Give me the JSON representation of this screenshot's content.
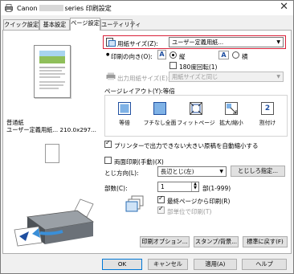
{
  "window": {
    "title_prefix": "Canon",
    "title_suffix": "series 印刷設定",
    "close_glyph": "✕"
  },
  "tabs": [
    {
      "label": "クイック設定"
    },
    {
      "label": "基本設定"
    },
    {
      "label": "ページ設定"
    },
    {
      "label": "ユーティリティ"
    }
  ],
  "preview": {
    "media_label": "普通紙",
    "size_label": "ユーザー定義用紙... 210.0x297..."
  },
  "paper_size": {
    "label": "用紙サイズ(Z):",
    "value": "ユーザー定義用紙..."
  },
  "orientation": {
    "label": "印刷の向き(O):",
    "portrait_label": "縦",
    "landscape_label": "横",
    "rotate_label": "180度回転(1)"
  },
  "output_size": {
    "label": "出力用紙サイズ(E):",
    "value": "用紙サイズと同じ"
  },
  "layout": {
    "label": "ページレイアウト(Y):等倍",
    "items": [
      {
        "label": "等倍"
      },
      {
        "label": "フチなし全面"
      },
      {
        "label": "フィットページ"
      },
      {
        "label": "拡大/縮小"
      },
      {
        "label": "割付け"
      }
    ],
    "paginate_number": "2"
  },
  "auto_reduce_label": "プリンターで出力できない大きい原稿を自動縮小する",
  "duplex": {
    "label": "両面印刷(手動)(X)",
    "binding_label": "とじ方向(L):",
    "binding_value": "長辺とじ(左)",
    "margin_button": "とじしろ指定..."
  },
  "copies": {
    "label": "部数(C):",
    "value": "1",
    "range": "部(1-999)",
    "last_page_label": "最終ページから印刷(R)",
    "collate_label": "部単位で印刷(T)"
  },
  "bottom_buttons": {
    "print_options": "印刷オプション...",
    "stamp": "スタンプ/背景...",
    "defaults": "標準に戻す(F)"
  },
  "dialog_buttons": {
    "ok": "OK",
    "cancel": "キャンセル",
    "apply": "適用(A)",
    "help": "ヘルプ"
  },
  "colors": {
    "highlight": "#d9213a",
    "accent": "#0078d7"
  }
}
